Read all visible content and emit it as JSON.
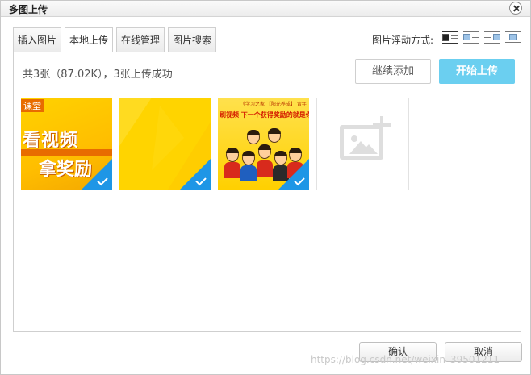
{
  "dialog": {
    "title": "多图上传"
  },
  "tabs": [
    {
      "label": "插入图片"
    },
    {
      "label": "本地上传",
      "active": true
    },
    {
      "label": "在线管理"
    },
    {
      "label": "图片搜索"
    }
  ],
  "float": {
    "label": "图片浮动方式:",
    "options": [
      "none",
      "left",
      "right",
      "center"
    ],
    "selected": "none"
  },
  "upload": {
    "status": "共3张（87.02K），3张上传成功",
    "continue_label": "继续添加",
    "start_label": "开始上传"
  },
  "thumbs": {
    "t1": {
      "tag": "课堂",
      "line1": "看视频",
      "line2": "拿奖励"
    },
    "t3": {
      "banner": "《学习之家 【阳光养成】 青年",
      "slogan": "刷视频 下一个获得奖励的就是你"
    }
  },
  "colors": {
    "accent": "#6bcff0",
    "check": "#1e96e6"
  },
  "footer": {
    "ok_label": "确认",
    "cancel_label": "取消"
  },
  "watermark": "https://blog.csdn.net/weixin_39501211"
}
